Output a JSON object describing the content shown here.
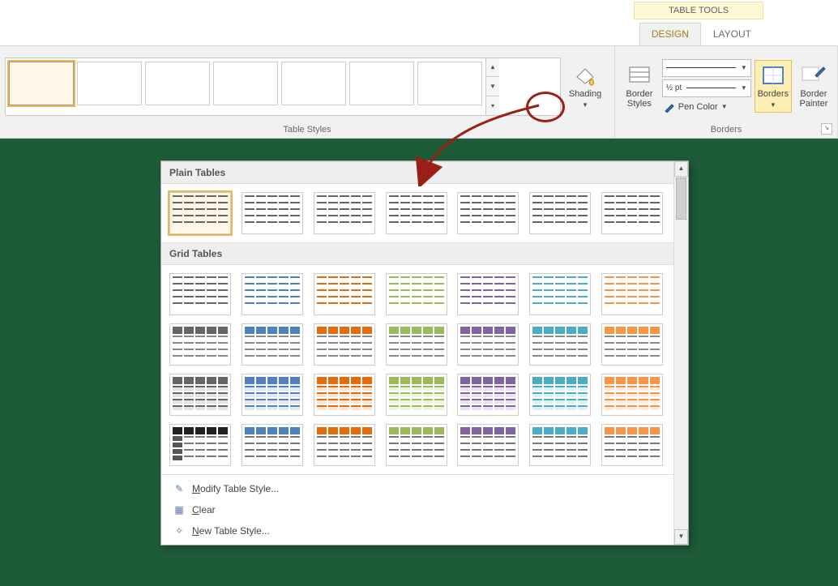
{
  "context_tab": "TABLE TOOLS",
  "tabs": {
    "design": "DESIGN",
    "layout": "LAYOUT",
    "active": "design"
  },
  "groups": {
    "styles_label": "Table Styles",
    "borders_label": "Borders"
  },
  "ribbon": {
    "shading": "Shading",
    "border_styles": "Border\nStyles",
    "line_weight": "½ pt",
    "pen_color": "Pen Color",
    "borders_btn": "Borders",
    "border_painter": "Border\nPainter"
  },
  "gallery": {
    "section_plain": "Plain Tables",
    "section_grid": "Grid Tables",
    "grid_colors": [
      "#666666",
      "#4f81bd",
      "#e46c0a",
      "#9bbb59",
      "#8064a2",
      "#4bacc6",
      "#f79646",
      "#76933c"
    ],
    "row_variants": [
      "light",
      "header",
      "header-band",
      "first-col"
    ],
    "footer": {
      "modify": "Modify Table Style...",
      "clear": "Clear",
      "new": "New Table Style..."
    }
  }
}
